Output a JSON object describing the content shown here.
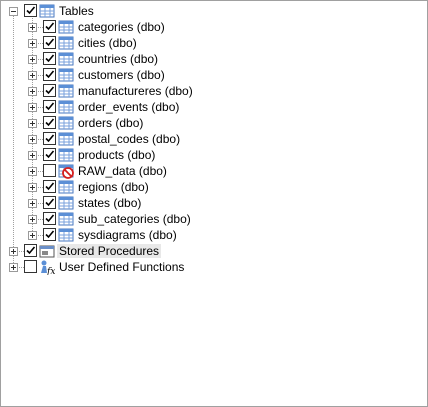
{
  "tree": {
    "tables": {
      "label": "Tables",
      "expanded": true,
      "checked": true,
      "icon": "table-folder-icon",
      "children": [
        {
          "label": "categories (dbo)",
          "checked": true,
          "icon": "table-icon"
        },
        {
          "label": "cities (dbo)",
          "checked": true,
          "icon": "table-icon"
        },
        {
          "label": "countries (dbo)",
          "checked": true,
          "icon": "table-icon"
        },
        {
          "label": "customers (dbo)",
          "checked": true,
          "icon": "table-icon"
        },
        {
          "label": "manufactureres (dbo)",
          "checked": true,
          "icon": "table-icon"
        },
        {
          "label": "order_events (dbo)",
          "checked": true,
          "icon": "table-icon"
        },
        {
          "label": "orders (dbo)",
          "checked": true,
          "icon": "table-icon"
        },
        {
          "label": "postal_codes (dbo)",
          "checked": true,
          "icon": "table-icon"
        },
        {
          "label": "products (dbo)",
          "checked": true,
          "icon": "table-icon"
        },
        {
          "label": "RAW_data (dbo)",
          "checked": false,
          "icon": "table-excluded-icon"
        },
        {
          "label": "regions (dbo)",
          "checked": true,
          "icon": "table-icon"
        },
        {
          "label": "states (dbo)",
          "checked": true,
          "icon": "table-icon"
        },
        {
          "label": "sub_categories (dbo)",
          "checked": true,
          "icon": "table-icon"
        },
        {
          "label": "sysdiagrams (dbo)",
          "checked": true,
          "icon": "table-icon"
        }
      ]
    },
    "stored_procedures": {
      "label": "Stored Procedures",
      "checked": true,
      "icon": "stored-procedure-icon"
    },
    "udf": {
      "label": "User Defined Functions",
      "checked": false,
      "icon": "function-icon"
    }
  },
  "colors": {
    "tree_line": "#a0a0a0",
    "table_blue": "#5b8fd6",
    "excluded_red": "#d42020",
    "selection": "#e8e8e8"
  }
}
